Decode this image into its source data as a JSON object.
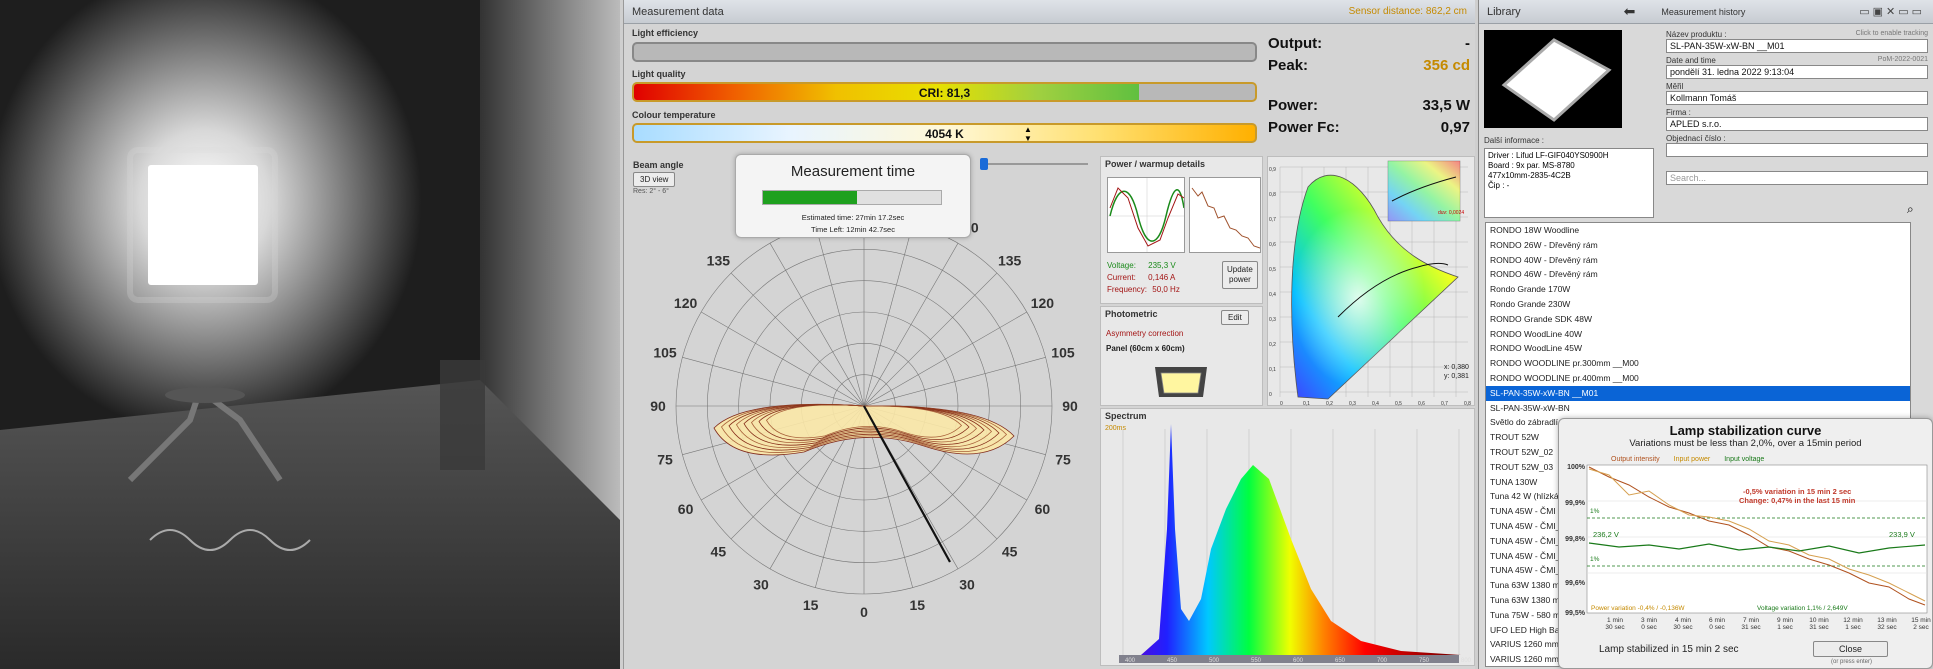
{
  "measurement": {
    "title": "Measurement data",
    "sensor_distance": "Sensor distance: 862,2 cm",
    "efficiency_label": "Light efficiency",
    "quality_label": "Light quality",
    "cri_text": "CRI: 81,3",
    "cri_value": 81.3,
    "colour_label": "Colour temperature",
    "cct_text": "4054 K",
    "output_label": "Output:",
    "output_value": "-",
    "peak_label": "Peak:",
    "peak_value": "356 cd",
    "power_label": "Power:",
    "power_value": "33,5 W",
    "powerfc_label": "Power Fc:",
    "powerfc_value": "0,97",
    "beam_label": "Beam angle",
    "view3d": "3D view",
    "res": "Res: 2° - 6°",
    "polar_angles": [
      "150",
      "135",
      "120",
      "105",
      "90",
      "75",
      "60",
      "45",
      "30",
      "15",
      "0",
      "15",
      "30",
      "45",
      "60",
      "75",
      "90",
      "105",
      "120",
      "135",
      "150"
    ]
  },
  "mtime": {
    "title": "Measurement time",
    "estimated": "Estimated time: 27min 17.2sec",
    "left": "Time Left: 12min 42.7sec",
    "progress": 0.53
  },
  "powerdetails": {
    "title": "Power / warmup details",
    "voltage_label": "Voltage:",
    "voltage_value": "235,3 V",
    "current_label": "Current:",
    "current_value": "0,146 A",
    "freq_label": "Frequency:",
    "freq_value": "50,0 Hz",
    "update_btn1": "Update",
    "update_btn2": "power"
  },
  "photometric": {
    "title": "Photometric",
    "edit": "Edit",
    "asym": "Asymmetry correction",
    "panel": "Panel (60cm x 60cm)"
  },
  "cie": {
    "x": "x: 0,380",
    "y": "y: 0,381",
    "duv": "duv: 0,0024",
    "yticks": [
      "0,9",
      "0,8",
      "0,7",
      "0,6",
      "0,5",
      "0,4",
      "0,3",
      "0,2",
      "0,1",
      "0"
    ],
    "xticks": [
      "0",
      "0,1",
      "0,2",
      "0,3",
      "0,4",
      "0,5",
      "0,6",
      "0,7",
      "0,8"
    ]
  },
  "spectrum": {
    "title": "Spectrum",
    "ms": "200ms",
    "xticks": [
      "400",
      "450",
      "500",
      "550",
      "600",
      "650",
      "700",
      "750",
      "800"
    ]
  },
  "library": {
    "title": "Library",
    "history": "Measurement history",
    "enable_tracking": "Click to enable tracking",
    "product_label": "Název produktu :",
    "product_value": "SL-PAN-35W-xW-BN __M01",
    "date_label": "Date and time",
    "date_code": "PoM-2022-0021",
    "date_value": "pondělí 31. ledna 2022  9:13:04",
    "measured_label": "Měřil",
    "measured_value": "Kollmann Tomáš",
    "company_label": "Firma :",
    "company_value": "APLED s.r.o.",
    "order_label": "Objednací číslo :",
    "order_value": "",
    "more_label": "Další informace :",
    "info_lines": [
      "Driver : Lifud LF-GIF040YS0900H",
      "",
      "Board : 9x par. MS-8780",
      "477x10mm-2835-4C2B",
      "",
      "Čip : -"
    ],
    "search_placeholder": "Search...",
    "items": [
      "RONDO 18W Woodline",
      "RONDO 26W - Dřevěný rám",
      "RONDO 40W - Dřevěný rám",
      "RONDO 46W - Dřevěný rám",
      "Rondo Grande 170W",
      "Rondo Grande 230W",
      "RONDO Grande SDK 48W",
      "RONDO WoodLine 40W",
      "RONDO WoodLine 45W",
      "RONDO WOODLINE pr.300mm __M00",
      "RONDO WOODLINE pr.400mm __M00",
      "SL-PAN-35W-xW-BN __M01",
      "SL-PAN-35W-xW-BN",
      "Světlo do zábradlí 5",
      "TROUT 52W",
      "TROUT 52W_02",
      "TROUT 52W_03",
      "TUNA 130W",
      "Tuna 42 W (hlízká",
      "TUNA 45W - ČMI",
      "TUNA 45W - ČMI_",
      "TUNA 45W - ČMI_",
      "TUNA 45W - ČMI_",
      "TUNA 45W - ČMI_",
      "Tuna 63W 1380 m",
      "Tuna 63W 1380 m",
      "Tuna 75W - 580 m",
      "UFO LED High Ba",
      "VARIUS 1260 mm",
      "VARIUS 1260 mm"
    ],
    "selected_index": 11
  },
  "stab": {
    "title": "Lamp stabilization curve",
    "subtitle": "Variations must be less than 2,0%, over a 15min period",
    "legend": [
      "Output intensity",
      "Input power",
      "Input voltage"
    ],
    "yticks": [
      "100%",
      "99,9%",
      "99,8%",
      "99,6%",
      "99,5%"
    ],
    "ann1": "-0,5% variation in 15 min 2 sec",
    "ann2": "Change: 0,47% in the last 15 min",
    "v_left": "236,2 V",
    "v_right": "233,9 V",
    "pct1": "1%",
    "pct2": "1%",
    "pv": "Power variation -0,4% / -0,136W",
    "vv": "Voltage variation 1,1% / 2,649V",
    "xticks": [
      [
        "1 min",
        "30 sec"
      ],
      [
        "3 min",
        "0 sec"
      ],
      [
        "4 min",
        "30 sec"
      ],
      [
        "6 min",
        "0 sec"
      ],
      [
        "7 min",
        "31 sec"
      ],
      [
        "9 min",
        "1 sec"
      ],
      [
        "10 min",
        "31 sec"
      ],
      [
        "12 min",
        "1 sec"
      ],
      [
        "13 min",
        "32 sec"
      ],
      [
        "15 min",
        "2 sec"
      ]
    ],
    "status": "Lamp stabilized in 15 min 2 sec",
    "close": "Close",
    "hint": "(or press enter)"
  }
}
